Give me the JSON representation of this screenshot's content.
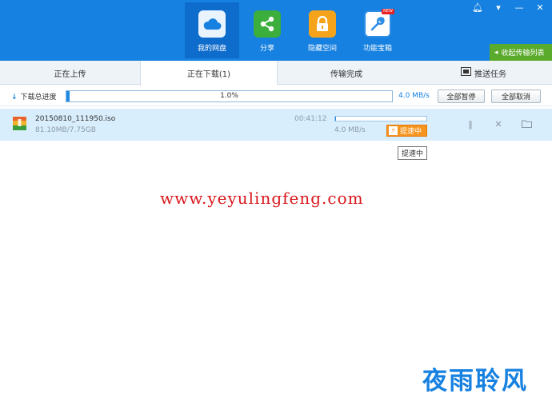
{
  "window": {
    "controls": [
      "bell-icon",
      "menu-icon",
      "minimize-icon",
      "close-icon"
    ]
  },
  "nav": {
    "items": [
      {
        "label": "我的网盘",
        "icon": "cloud-icon",
        "active": true
      },
      {
        "label": "分享",
        "icon": "share-icon",
        "active": false
      },
      {
        "label": "隐藏空间",
        "icon": "lock-icon",
        "active": false
      },
      {
        "label": "功能宝箱",
        "icon": "wrench-icon",
        "active": false,
        "badge": "NEW"
      }
    ],
    "collapse_label": "收起传输列表"
  },
  "tabs": [
    {
      "label": "正在上传",
      "active": false
    },
    {
      "label": "正在下载(1)",
      "active": true
    },
    {
      "label": "传输完成",
      "active": false
    },
    {
      "label": "推送任务",
      "active": false,
      "icon": "push-icon"
    }
  ],
  "progress": {
    "label": "下载总进度",
    "percent_text": "1.0%",
    "percent": 1.0,
    "speed": "4.0 MB/s",
    "pause_all": "全部暂停",
    "cancel_all": "全部取消"
  },
  "task": {
    "filename": "20150810_111950.iso",
    "size": "81.10MB/7.75GB",
    "time_left": "00:41:12",
    "speed": "4.0 MB/s",
    "progress": 1.0,
    "boost_label": "提速中",
    "tooltip": "提速中"
  },
  "watermarks": {
    "url": "www.yeyulingfeng.com",
    "logo": "夜雨聆风"
  },
  "colors": {
    "header": "#1681e0",
    "header_active": "#0e6ccc",
    "task_row": "#d9eefc",
    "boost": "#f7941d",
    "collapse": "#5aaa2c",
    "watermark_url": "#d8171c"
  }
}
